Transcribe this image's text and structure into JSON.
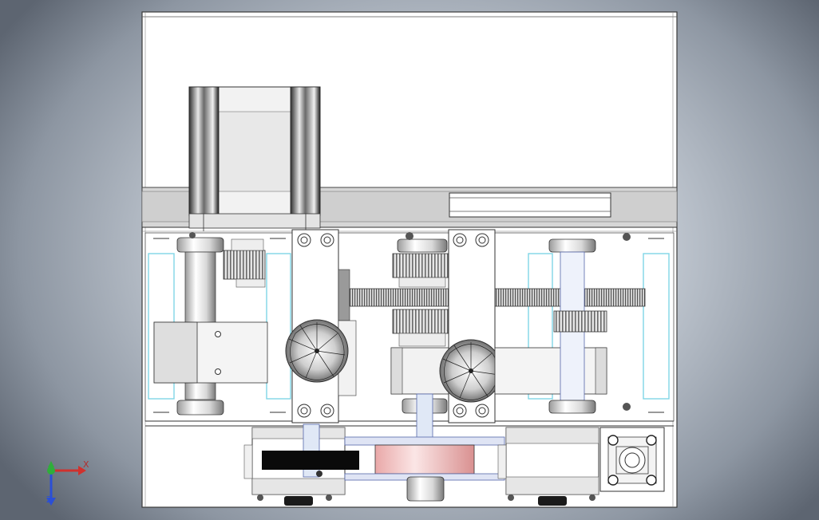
{
  "viewport": {
    "background_inner": "#dfe4ea",
    "background_outer": "#5d6571"
  },
  "triad": {
    "x_label": "X",
    "z_label": "Z",
    "x_color": "#d0312d",
    "y_color": "#2fae3a",
    "z_color": "#2b4fd6"
  }
}
